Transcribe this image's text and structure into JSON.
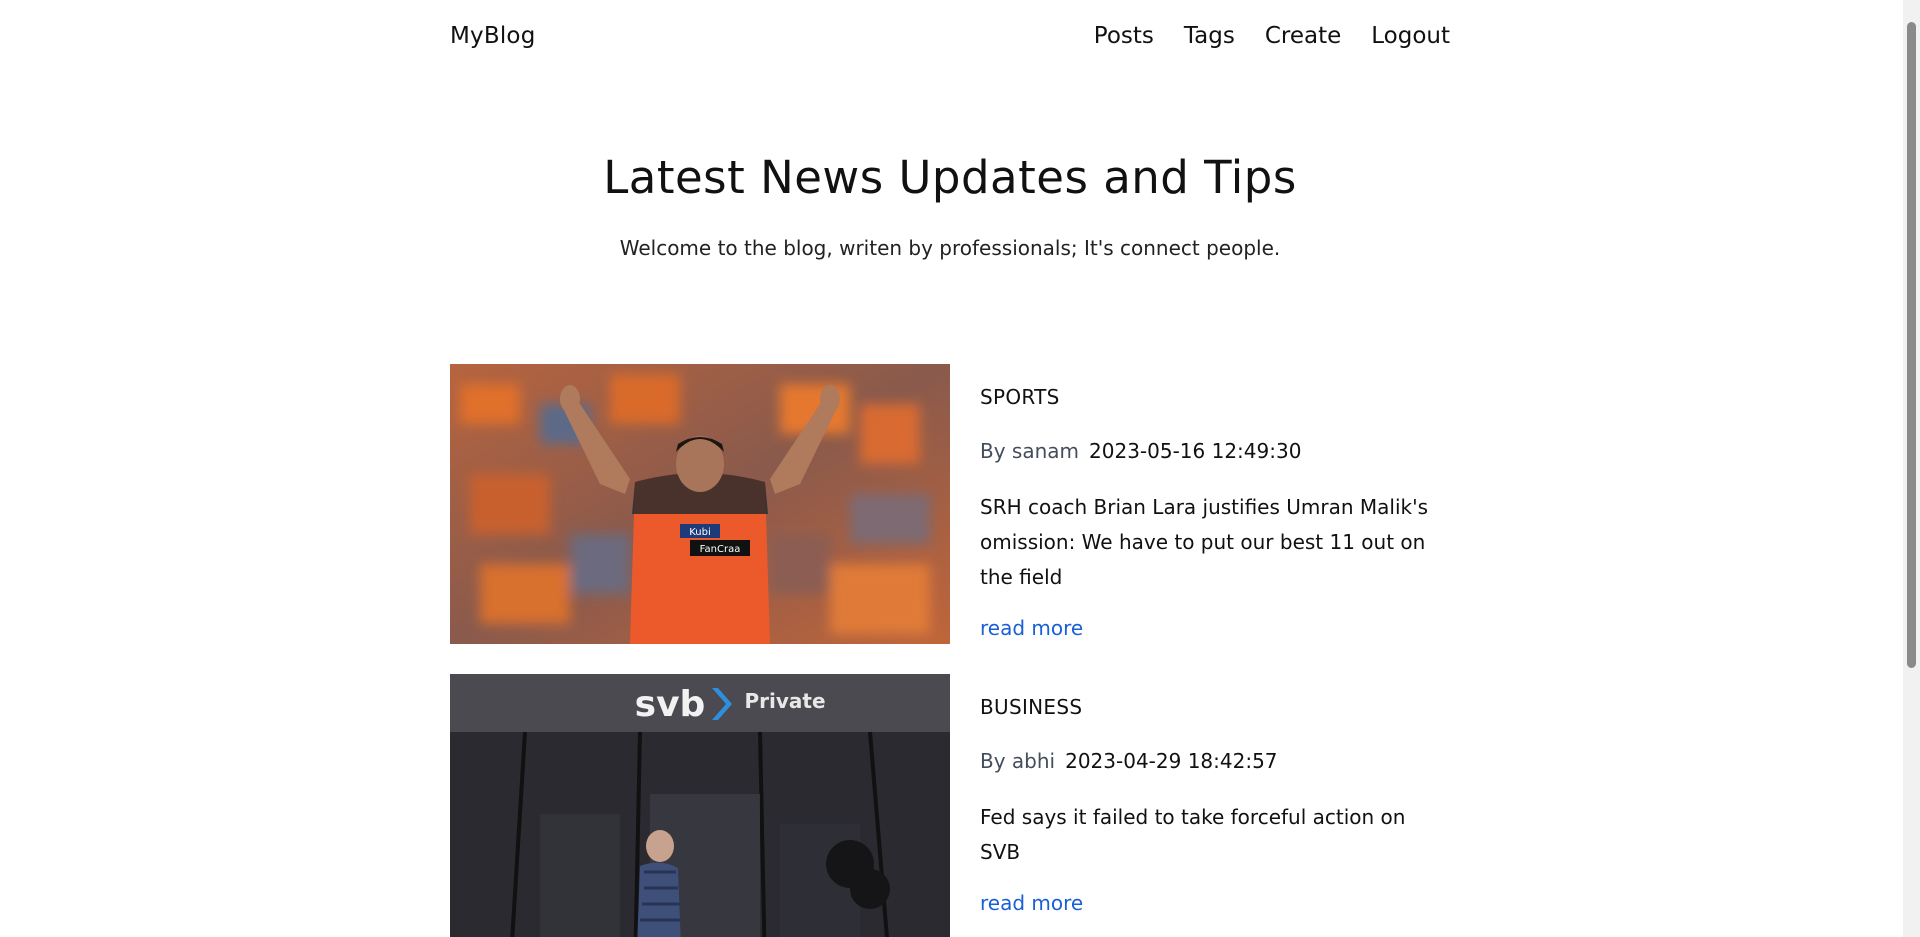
{
  "nav": {
    "brand": "MyBlog",
    "links": [
      "Posts",
      "Tags",
      "Create",
      "Logout"
    ]
  },
  "hero": {
    "title": "Latest News Updates and Tips",
    "subtitle": "Welcome to the blog, writen by professionals; It's connect people."
  },
  "posts": [
    {
      "category": "SPORTS",
      "author": "By sanam",
      "date": "2023-05-16 12:49:30",
      "title": "SRH coach Brian Lara justifies Umran Malik's omission: We have to put our best 11 out on the field",
      "read_more": "read more",
      "image": {
        "jersey_text_1": "Kubi",
        "jersey_text_2": "FanCraa"
      }
    },
    {
      "category": "BUSINESS",
      "author": "By abhi",
      "date": "2023-04-29 18:42:57",
      "title": "Fed says it failed to take forceful action on SVB",
      "read_more": "read more",
      "image": {
        "sign_brand": "svb",
        "sign_label": "Private"
      }
    }
  ],
  "colors": {
    "link": "#1a5fd6",
    "author": "#444d5c",
    "text": "#111111"
  }
}
